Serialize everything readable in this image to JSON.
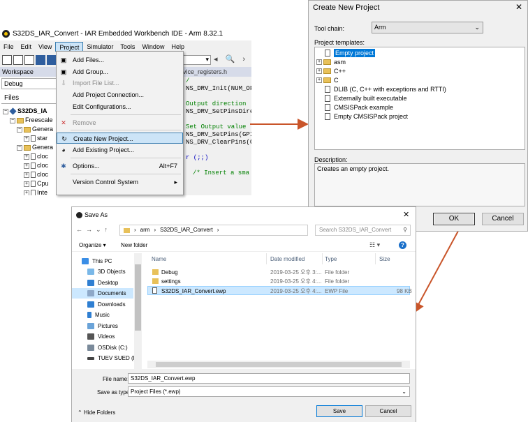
{
  "ide": {
    "title": "S32DS_IAR_Convert - IAR Embedded Workbench IDE - Arm 8.32.1",
    "menu": [
      "File",
      "Edit",
      "View",
      "Project",
      "Simulator",
      "Tools",
      "Window",
      "Help"
    ],
    "workspace_label": "Workspace",
    "code_tab": "vice_registers.h",
    "config": "Debug",
    "files_header": "Files",
    "tree": [
      "S32DS_IA",
      "Freescale",
      "Genera",
      "star",
      "Genera",
      "cloc",
      "cloc",
      "cloc",
      "Cpu",
      "Inte"
    ],
    "code_lines": [
      "/",
      "NS_DRV_Init(NUM_OF",
      "",
      "Output direction",
      "NS_DRV_SetPinsDirec",
      "",
      "Set Output value",
      "NS_DRV_SetPins(GPI",
      "NS_DRV_ClearPins(G",
      "",
      "r (;;)",
      "",
      "/* Insert a sma"
    ]
  },
  "project_menu": {
    "items": [
      {
        "label": "Add Files...",
        "enabled": true
      },
      {
        "label": "Add Group...",
        "enabled": true
      },
      {
        "label": "Import File List...",
        "enabled": false
      },
      {
        "label": "Add Project Connection...",
        "enabled": true
      },
      {
        "label": "Edit Configurations...",
        "enabled": true
      },
      {
        "label": "Remove",
        "enabled": false
      },
      {
        "label": "Create New Project...",
        "enabled": true
      },
      {
        "label": "Add Existing Project...",
        "enabled": true
      },
      {
        "label": "Options...",
        "enabled": true,
        "shortcut": "Alt+F7"
      },
      {
        "label": "Version Control System",
        "enabled": true
      }
    ]
  },
  "create_project": {
    "title": "Create New Project",
    "close": "✕",
    "toolchain_label": "Tool chain:",
    "toolchain_value": "Arm",
    "templates_label": "Project templates:",
    "templates": [
      "Empty project",
      "asm",
      "C++",
      "C",
      "DLIB (C, C++ with exceptions and RTTI)",
      "Externally built executable",
      "CMSISPack example",
      "Empty CMSISPack project"
    ],
    "description_label": "Description:",
    "description": "Creates an empty project.",
    "ok": "OK",
    "cancel": "Cancel"
  },
  "save_as": {
    "title": "Save As",
    "close": "✕",
    "path": [
      "arm",
      "S32DS_IAR_Convert"
    ],
    "search_placeholder": "Search S32DS_IAR_Convert",
    "organize": "Organize ▾",
    "new_folder": "New folder",
    "sidebar": [
      "This PC",
      "3D Objects",
      "Desktop",
      "Documents",
      "Downloads",
      "Music",
      "Pictures",
      "Videos",
      "OSDisk (C:)",
      "TUEV SUED (D:)"
    ],
    "columns": {
      "name": "Name",
      "date": "Date modified",
      "type": "Type",
      "size": "Size"
    },
    "files": [
      {
        "name": "Debug",
        "date": "2019-03-25 오후 3:...",
        "type": "File folder",
        "size": ""
      },
      {
        "name": "settings",
        "date": "2019-03-25 오후 4:...",
        "type": "File folder",
        "size": ""
      },
      {
        "name": "S32DS_IAR_Convert.ewp",
        "date": "2019-03-25 오후 4:...",
        "type": "EWP File",
        "size": "98 KB"
      }
    ],
    "filename_label": "File name:",
    "filename_value": "S32DS_IAR_Convert.ewp",
    "type_label": "Save as type:",
    "type_value": "Project Files (*.ewp)",
    "hide_folders": "Hide Folders",
    "save": "Save",
    "cancel": "Cancel"
  },
  "colors": {
    "arrow": "#c9552a",
    "selection": "#0078d7",
    "folder": "#e8c15a"
  }
}
